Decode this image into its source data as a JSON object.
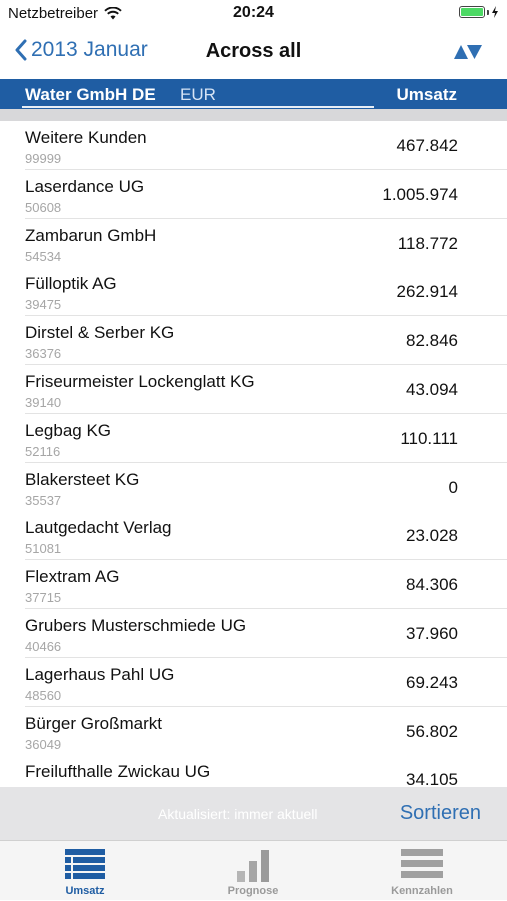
{
  "status": {
    "carrier": "Netzbetreiber",
    "time": "20:24"
  },
  "nav": {
    "back_label": "2013 Januar",
    "title": "Across all"
  },
  "header": {
    "company": "Water GmbH DE",
    "currency": "EUR",
    "column": "Umsatz"
  },
  "rows": [
    {
      "name": "Weitere Kunden",
      "number": "99999",
      "value": "467.842"
    },
    {
      "name": "Laserdance UG",
      "number": "50608",
      "value": "1.005.974"
    },
    {
      "name": "Zambarun GmbH",
      "number": "54534",
      "value": "118.772"
    },
    {
      "name": "Fülloptik AG",
      "number": "39475",
      "value": "262.914"
    },
    {
      "name": "Dirstel & Serber KG",
      "number": "36376",
      "value": "82.846"
    },
    {
      "name": "Friseurmeister Lockenglatt KG",
      "number": "39140",
      "value": "43.094"
    },
    {
      "name": "Legbag KG",
      "number": "52116",
      "value": "110.111"
    },
    {
      "name": "Blakersteet KG",
      "number": "35537",
      "value": "0"
    },
    {
      "name": "Lautgedacht Verlag",
      "number": "51081",
      "value": "23.028"
    },
    {
      "name": "Flextram AG",
      "number": "37715",
      "value": "84.306"
    },
    {
      "name": "Grubers Musterschmiede UG",
      "number": "40466",
      "value": "37.960"
    },
    {
      "name": "Lagerhaus Pahl UG",
      "number": "48560",
      "value": "69.243"
    },
    {
      "name": "Bürger Großmarkt",
      "number": "36049",
      "value": "56.802"
    },
    {
      "name": "Freilufthalle Zwickau UG",
      "number": "",
      "value": "34.105"
    }
  ],
  "footer": {
    "updated": "Aktualisiert: immer aktuell",
    "sort_label": "Sortieren"
  },
  "tabs": [
    {
      "label": "Umsatz",
      "icon": "list-icon",
      "active": true
    },
    {
      "label": "Prognose",
      "icon": "bar-chart-icon",
      "active": false
    },
    {
      "label": "Kennzahlen",
      "icon": "menu-icon",
      "active": false
    }
  ],
  "colors": {
    "accent": "#2f6fb3",
    "header_bg": "#1f5da3",
    "tab_active": "#1f5da3",
    "tab_inactive": "#9a9a9a"
  }
}
